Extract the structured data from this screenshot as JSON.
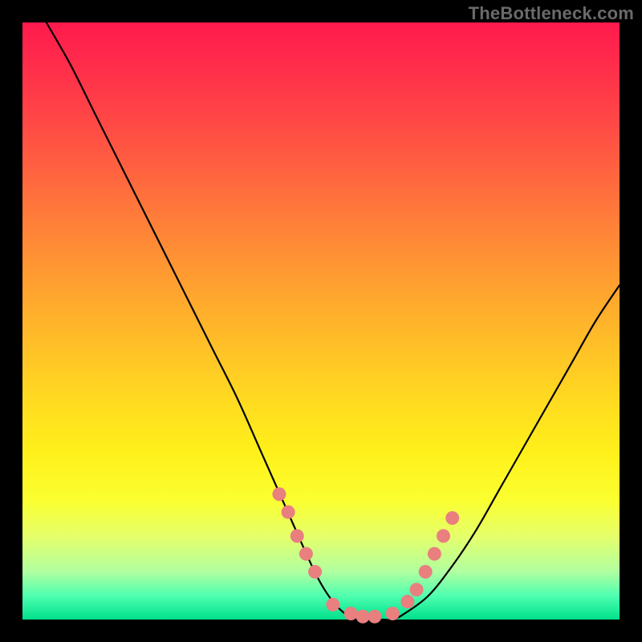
{
  "watermark": "TheBottleneck.com",
  "colors": {
    "frame": "#000000",
    "curve": "#000000",
    "dots": "#e97f7f"
  },
  "chart_data": {
    "type": "line",
    "title": "",
    "xlabel": "",
    "ylabel": "",
    "xlim": [
      0,
      100
    ],
    "ylim": [
      0,
      100
    ],
    "grid": false,
    "legend": false,
    "series": [
      {
        "name": "bottleneck-curve",
        "x": [
          4,
          8,
          12,
          16,
          20,
          24,
          28,
          32,
          36,
          40,
          44,
          48,
          50,
          52,
          54,
          56,
          58,
          60,
          62,
          64,
          68,
          72,
          76,
          80,
          84,
          88,
          92,
          96,
          100
        ],
        "y": [
          100,
          93,
          85,
          77,
          69,
          61,
          53,
          45,
          37,
          28,
          19,
          10,
          6,
          3,
          1,
          0,
          0,
          0,
          0,
          1,
          4,
          9,
          15,
          22,
          29,
          36,
          43,
          50,
          56
        ]
      }
    ],
    "marked_points": {
      "name": "highlighted-dots",
      "x": [
        43,
        44.5,
        46,
        47.5,
        49,
        52,
        55,
        57,
        59,
        62,
        64.5,
        66,
        67.5,
        69,
        70.5,
        72
      ],
      "y": [
        21,
        18,
        14,
        11,
        8,
        2.5,
        1,
        0.5,
        0.5,
        1,
        3,
        5,
        8,
        11,
        14,
        17
      ]
    }
  }
}
